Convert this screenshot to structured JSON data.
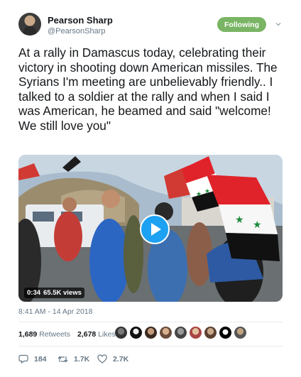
{
  "user": {
    "name": "Pearson Sharp",
    "handle": "@PearsonSharp",
    "follow_label": "Following"
  },
  "tweet": {
    "text": "At a rally in Damascus today, celebrating their victory in shooting down American missiles. The Syrians I'm meeting are unbelievably friendly.. I talked to a soldier at the rally and when I said I was American, he beamed and said \"welcome! We still love you\"",
    "timestamp": "8:41 AM - 14 Apr 2018"
  },
  "video": {
    "duration": "0:34",
    "views": "65.5K views"
  },
  "stats": {
    "retweets_count": "1,689",
    "retweets_label": "Retweets",
    "likes_count": "2,678",
    "likes_label": "Likes"
  },
  "actions": {
    "replies": "184",
    "retweets": "1.7K",
    "likes": "2.7K"
  },
  "colors": {
    "follow_green": "#79b564",
    "play_blue": "#1da1f2",
    "muted": "#657786"
  }
}
